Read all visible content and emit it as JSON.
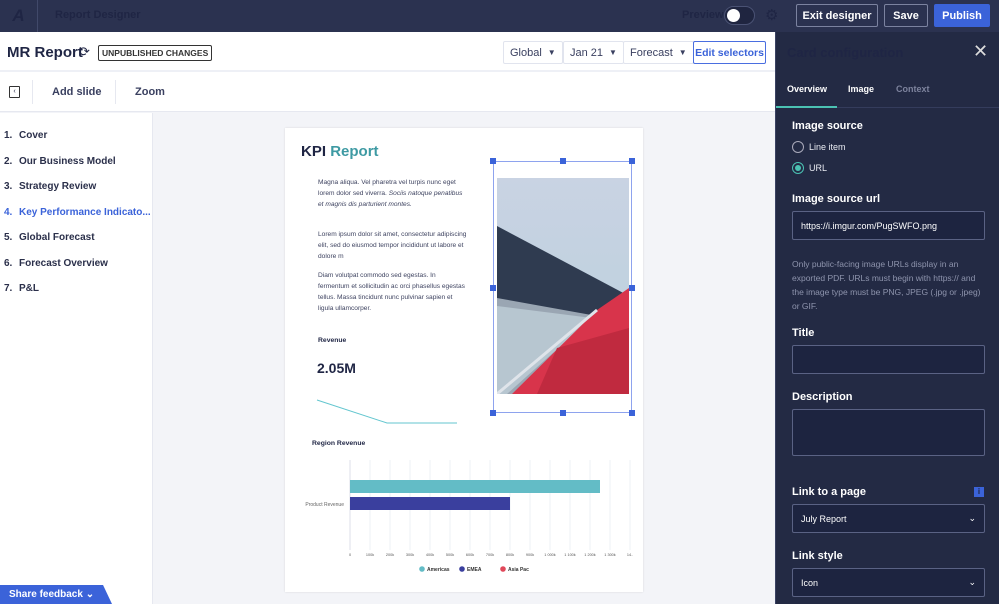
{
  "topbar": {
    "logo": "A",
    "app_title": "Report Designer",
    "preview_label": "Preview",
    "preview_on": false,
    "exit_label": "Exit designer",
    "save_label": "Save",
    "publish_label": "Publish"
  },
  "header": {
    "report_title": "MR Report",
    "status_badge": "UNPUBLISHED CHANGES",
    "selectors": [
      "Global",
      "Jan 21",
      "Forecast"
    ],
    "edit_selectors": "Edit selectors"
  },
  "toolbar": {
    "add_slide": "Add slide",
    "zoom": "Zoom"
  },
  "slides": [
    {
      "n": "1.",
      "label": "Cover"
    },
    {
      "n": "2.",
      "label": "Our Business Model"
    },
    {
      "n": "3.",
      "label": "Strategy Review"
    },
    {
      "n": "4.",
      "label": "Key Performance Indicato..."
    },
    {
      "n": "5.",
      "label": "Global Forecast"
    },
    {
      "n": "6.",
      "label": "Forecast Overview"
    },
    {
      "n": "7.",
      "label": "P&L"
    }
  ],
  "active_slide": 3,
  "feedback": "Share feedback",
  "page": {
    "title_a": "KPI",
    "title_b": "Report",
    "p1": "Magna aliqua. Vel pharetra vel turpis nunc eget lorem dolor sed viverra.",
    "p1_italic": "Sociis natoque penatibus et magnis dis parturient montes.",
    "p2": "Lorem ipsum dolor sit amet, consectetur adipiscing elit, sed do eiusmod tempor incididunt ut labore et dolore m",
    "p3": "Diam volutpat commodo sed egestas. In fermentum et sollicitudin ac orci phasellus egestas tellus. Massa tincidunt nunc pulvinar sapien et ligula ullamcorper.",
    "revenue_label": "Revenue",
    "revenue_value": "2.05M",
    "region_title": "Region Revenue"
  },
  "chart_data": {
    "type": "bar",
    "orientation": "horizontal",
    "title": "Region Revenue",
    "categories": [
      "Product Revenue"
    ],
    "series": [
      {
        "name": "Americas",
        "values": [
          1250
        ],
        "color": "#63bcc6"
      },
      {
        "name": "EMEA",
        "values": [
          800
        ],
        "color": "#3a3f9e"
      },
      {
        "name": "Asia Pac",
        "values": [
          0
        ],
        "color": "#e0485a"
      }
    ],
    "xlim": [
      0,
      1400
    ],
    "xticks": [
      "0",
      "100k",
      "200k",
      "300k",
      "400k",
      "500k",
      "600k",
      "700k",
      "800k",
      "900k",
      "1 000k",
      "1 100k",
      "1 200k",
      "1 300k",
      "14.."
    ],
    "legend": "bottom",
    "grid": true,
    "sparkline": {
      "values": [
        3,
        1,
        1
      ],
      "color": "#63c6cf"
    }
  },
  "panel": {
    "title": "Card configuration",
    "tabs": [
      "Overview",
      "Image",
      "Context"
    ],
    "image_source_label": "Image source",
    "options": [
      "Line item",
      "URL"
    ],
    "selected_option": 1,
    "url_label": "Image source url",
    "url_value": "https://i.imgur.com/PugSWFO.png",
    "help": "Only public-facing image URLs display in an exported PDF. URLs must begin with https:// and the image type must be PNG, JPEG (.jpg or .jpeg) or GIF.",
    "title_label": "Title",
    "title_value": "",
    "description_label": "Description",
    "description_value": "",
    "link_label": "Link to a page",
    "link_value": "July Report",
    "link_style_label": "Link style",
    "link_style_value": "Icon",
    "info": "i"
  }
}
